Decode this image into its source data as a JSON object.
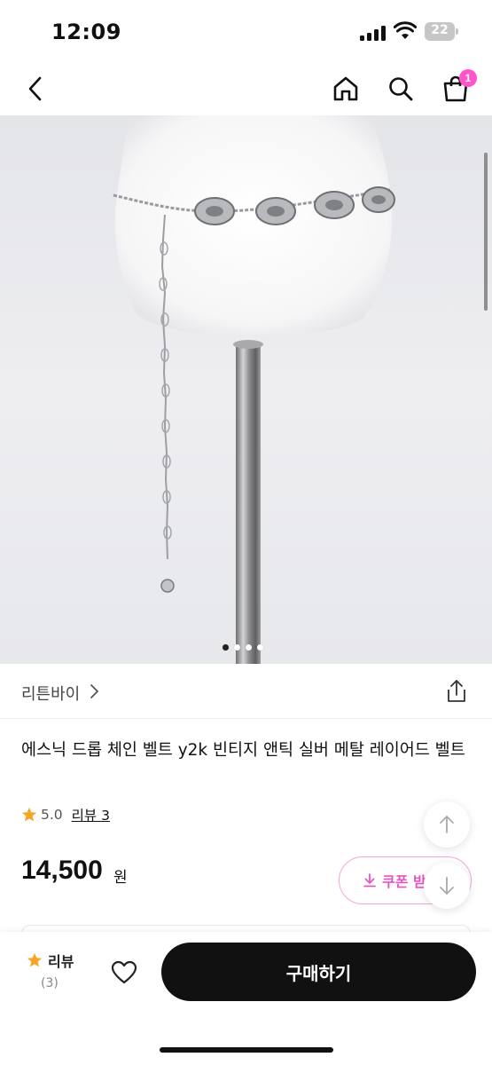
{
  "status_bar": {
    "time": "12:09",
    "battery": "22"
  },
  "nav": {
    "cart_badge": "1"
  },
  "gallery": {
    "total_images": 4,
    "active_index": 0
  },
  "shop": {
    "name": "리튼바이"
  },
  "product": {
    "title": "에스닉 드롭 체인 벨트 y2k 빈티지 앤틱 실버 메탈 레이어드 벨트",
    "rating": "5.0",
    "review_link": "리뷰 3",
    "price": "14,500",
    "price_unit": "원"
  },
  "coupon": {
    "label": "쿠폰 받"
  },
  "bottom_bar": {
    "review_label": "리뷰",
    "review_count": "(3)",
    "buy_label": "구매하기"
  },
  "colors": {
    "accent_pink": "#ff55c8",
    "coupon_pink": "#e756c0",
    "star": "#f5a623",
    "primary": "#111111"
  }
}
